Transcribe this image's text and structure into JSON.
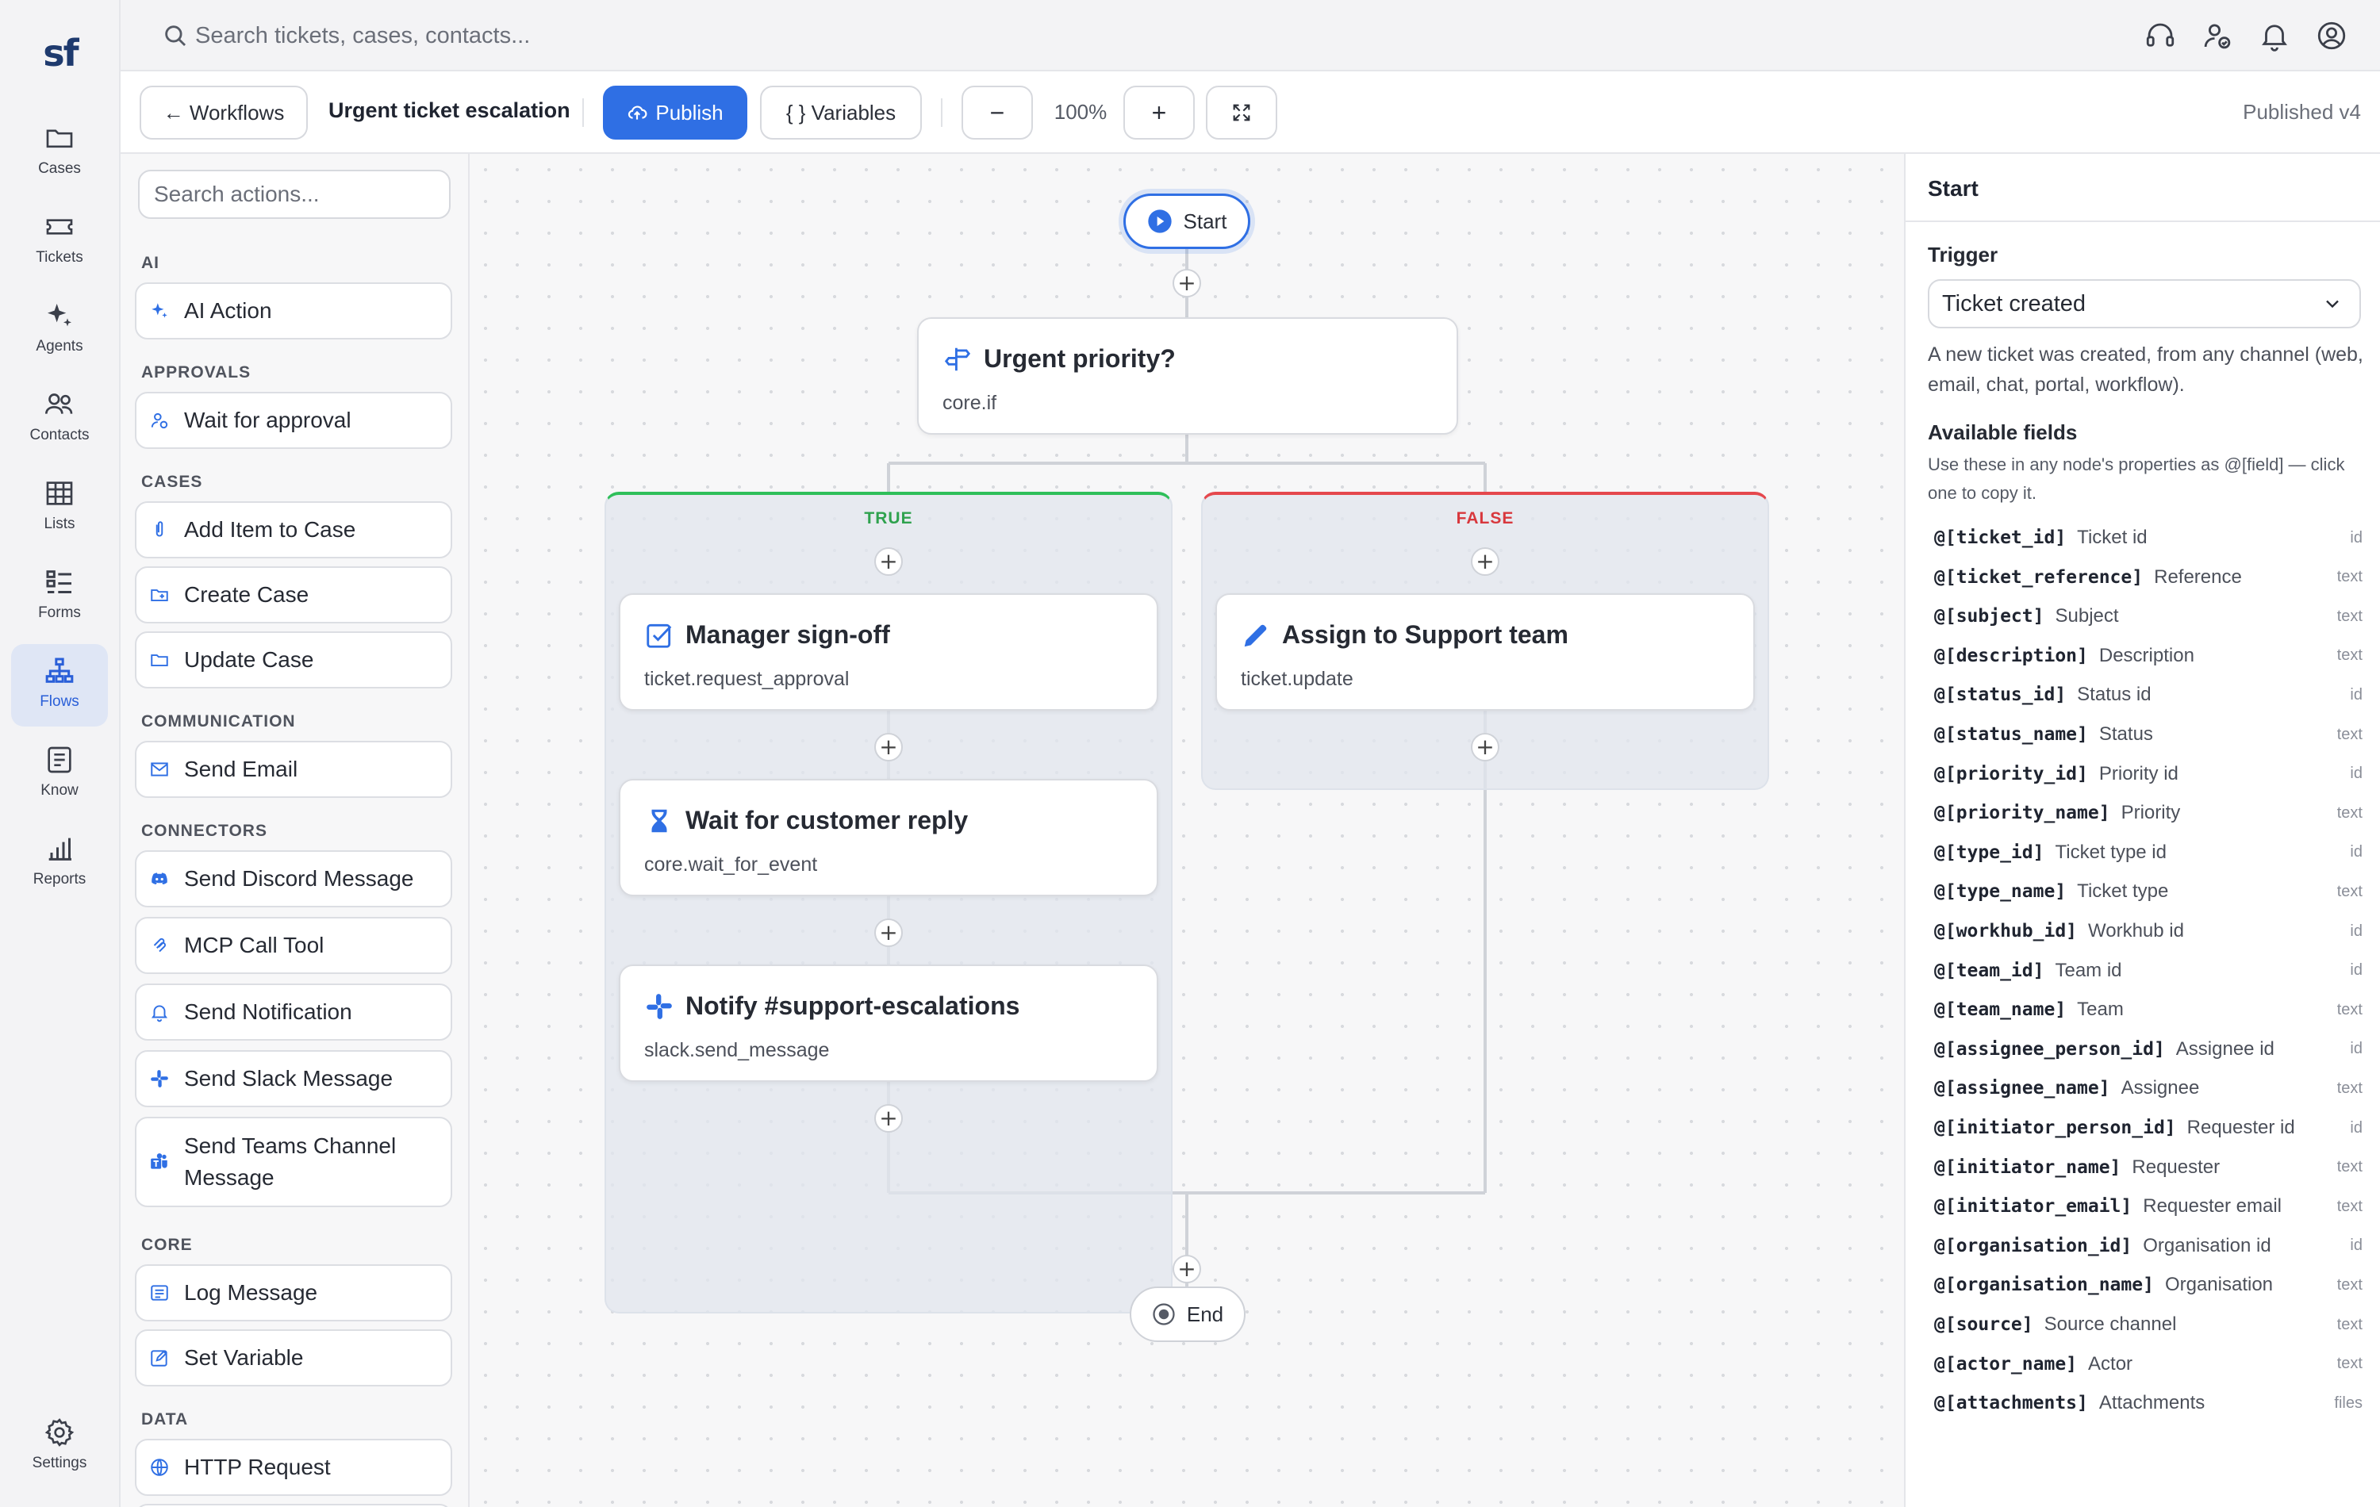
{
  "app": {
    "logo_text": "sf",
    "search_placeholder": "Search tickets, cases, contacts..."
  },
  "nav": [
    {
      "label": "Cases",
      "icon": "folder-icon"
    },
    {
      "label": "Tickets",
      "icon": "ticket-icon"
    },
    {
      "label": "Agents",
      "icon": "sparkles-icon"
    },
    {
      "label": "Contacts",
      "icon": "users-icon"
    },
    {
      "label": "Lists",
      "icon": "table-icon"
    },
    {
      "label": "Forms",
      "icon": "checklist-icon"
    },
    {
      "label": "Flows",
      "icon": "workflow-icon",
      "active": true
    },
    {
      "label": "Know",
      "icon": "document-icon"
    },
    {
      "label": "Reports",
      "icon": "bar-chart-icon"
    },
    {
      "label": "Settings",
      "icon": "gear-icon"
    }
  ],
  "toolbar": {
    "back_label": "← Workflows",
    "title": "Urgent ticket escalation",
    "publish_label": "Publish",
    "variables_label": "{ } Variables",
    "zoom": "100%",
    "zoom_out": "−",
    "zoom_in": "+",
    "status": "Published v4"
  },
  "palette": {
    "search_placeholder": "Search actions...",
    "categories": [
      {
        "name": "AI",
        "items": [
          "AI Action"
        ]
      },
      {
        "name": "APPROVALS",
        "items": [
          "Wait for approval"
        ]
      },
      {
        "name": "CASES",
        "items": [
          "Add Item to Case",
          "Create Case",
          "Update Case"
        ]
      },
      {
        "name": "COMMUNICATION",
        "items": [
          "Send Email"
        ]
      },
      {
        "name": "CONNECTORS",
        "items": [
          "Send Discord Message",
          "MCP Call Tool",
          "Send Notification",
          "Send Slack Message",
          "Send Teams Channel Message"
        ]
      },
      {
        "name": "CORE",
        "items": [
          "Log Message",
          "Set Variable"
        ]
      },
      {
        "name": "DATA",
        "items": [
          "HTTP Request"
        ]
      }
    ]
  },
  "canvas": {
    "start_label": "Start",
    "end_label": "End",
    "plus": "+",
    "condition": {
      "title": "Urgent priority?",
      "type": "core.if"
    },
    "true_label": "TRUE",
    "false_label": "FALSE",
    "true_nodes": [
      {
        "title": "Manager sign-off",
        "type": "ticket.request_approval"
      },
      {
        "title": "Wait for customer reply",
        "type": "core.wait_for_event"
      },
      {
        "title": "Notify #support-escalations",
        "type": "slack.send_message"
      }
    ],
    "false_nodes": [
      {
        "title": "Assign to Support team",
        "type": "ticket.update"
      }
    ],
    "colors": {
      "true": "#2fbf5a",
      "false": "#e5484d",
      "accent": "#2f6fe4"
    }
  },
  "panel": {
    "title": "Start",
    "trigger_label": "Trigger",
    "trigger_value": "Ticket created",
    "trigger_desc": "A new ticket was created, from any channel (web, email, chat, portal, workflow).",
    "fields_label": "Available fields",
    "fields_desc": "Use these in any node's properties as @[field] — click one to copy it.",
    "fields": [
      {
        "key": "@[ticket_id]",
        "name": "Ticket id",
        "type": "id"
      },
      {
        "key": "@[ticket_reference]",
        "name": "Reference",
        "type": "text"
      },
      {
        "key": "@[subject]",
        "name": "Subject",
        "type": "text"
      },
      {
        "key": "@[description]",
        "name": "Description",
        "type": "text"
      },
      {
        "key": "@[status_id]",
        "name": "Status id",
        "type": "id"
      },
      {
        "key": "@[status_name]",
        "name": "Status",
        "type": "text"
      },
      {
        "key": "@[priority_id]",
        "name": "Priority id",
        "type": "id"
      },
      {
        "key": "@[priority_name]",
        "name": "Priority",
        "type": "text"
      },
      {
        "key": "@[type_id]",
        "name": "Ticket type id",
        "type": "id"
      },
      {
        "key": "@[type_name]",
        "name": "Ticket type",
        "type": "text"
      },
      {
        "key": "@[workhub_id]",
        "name": "Workhub id",
        "type": "id"
      },
      {
        "key": "@[team_id]",
        "name": "Team id",
        "type": "id"
      },
      {
        "key": "@[team_name]",
        "name": "Team",
        "type": "text"
      },
      {
        "key": "@[assignee_person_id]",
        "name": "Assignee id",
        "type": "id"
      },
      {
        "key": "@[assignee_name]",
        "name": "Assignee",
        "type": "text"
      },
      {
        "key": "@[initiator_person_id]",
        "name": "Requester id",
        "type": "id"
      },
      {
        "key": "@[initiator_name]",
        "name": "Requester",
        "type": "text"
      },
      {
        "key": "@[initiator_email]",
        "name": "Requester email",
        "type": "text"
      },
      {
        "key": "@[organisation_id]",
        "name": "Organisation id",
        "type": "id"
      },
      {
        "key": "@[organisation_name]",
        "name": "Organisation",
        "type": "text"
      },
      {
        "key": "@[source]",
        "name": "Source channel",
        "type": "text"
      },
      {
        "key": "@[actor_name]",
        "name": "Actor",
        "type": "text"
      },
      {
        "key": "@[attachments]",
        "name": "Attachments",
        "type": "files"
      }
    ]
  }
}
